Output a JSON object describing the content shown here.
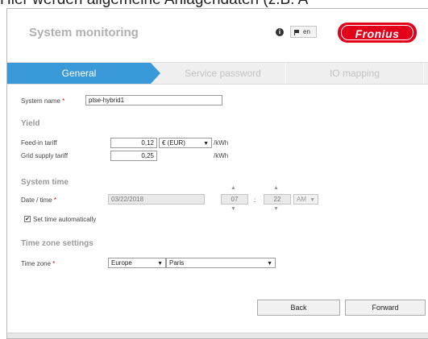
{
  "caption": "Hier werden allgemeine Anlagendaten (z.B. A",
  "app": {
    "title": "System monitoring",
    "language": "en",
    "logo_text": "Fronius"
  },
  "tabs": [
    "General",
    "Service password",
    "IO mapping"
  ],
  "form": {
    "system_name_label": "System name",
    "required_mark": "*",
    "system_name_value": "ptse-hybrid1",
    "yield_heading": "Yield",
    "feed_in_label": "Feed-in tariff",
    "feed_in_value": "0,12",
    "currency": "€ (EUR)",
    "feed_in_unit": "/kWh",
    "grid_supply_label": "Grid supply tariff",
    "grid_supply_value": "0,25",
    "grid_supply_unit": "/kWh",
    "system_time_heading": "System time",
    "date_time_label": "Date / time",
    "date_value": "03/22/2018",
    "hour_value": "07",
    "time_sep": ":",
    "minute_value": "22",
    "ampm_value": "AM",
    "set_time_auto_label": "Set time automatically",
    "set_time_auto_checked": true,
    "timezone_heading": "Time zone settings",
    "timezone_label": "Time zone",
    "region_value": "Europe",
    "city_value": "Paris"
  },
  "buttons": {
    "back": "Back",
    "forward": "Forward"
  },
  "colors": {
    "accent": "#3a9ad9",
    "brand": "#e2001a"
  }
}
